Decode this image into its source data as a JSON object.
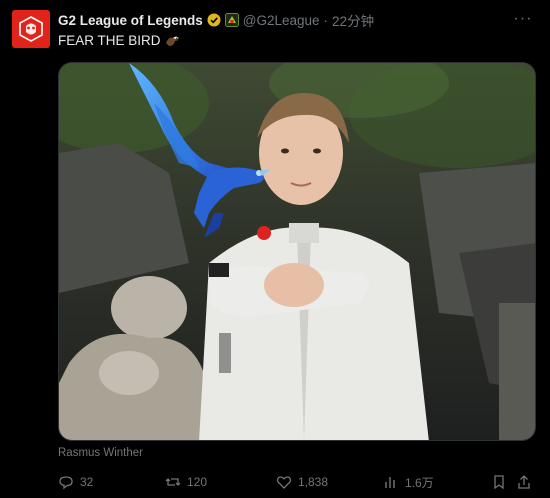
{
  "tweet": {
    "account_name": "G2 League of Legends",
    "handle": "@G2League",
    "separator": "·",
    "time": "22分钟",
    "text": "FEAR THE BIRD",
    "media_caption": "Rasmus Winther",
    "more_label": "···"
  },
  "actions": {
    "replies": "32",
    "reposts": "120",
    "likes": "1,838",
    "views": "1.6万"
  },
  "icons": {
    "verified": "verified-badge-icon",
    "affiliate": "affiliate-badge-icon",
    "eagle": "eagle-emoji-icon",
    "reply": "reply-icon",
    "repost": "repost-icon",
    "like": "heart-icon",
    "views": "views-icon",
    "bookmark": "bookmark-icon",
    "share": "share-icon"
  },
  "colors": {
    "background": "#000000",
    "brand_red": "#e2231a",
    "gold_badge": "#e2b719",
    "muted": "#71767b",
    "text": "#e7e9ea"
  }
}
